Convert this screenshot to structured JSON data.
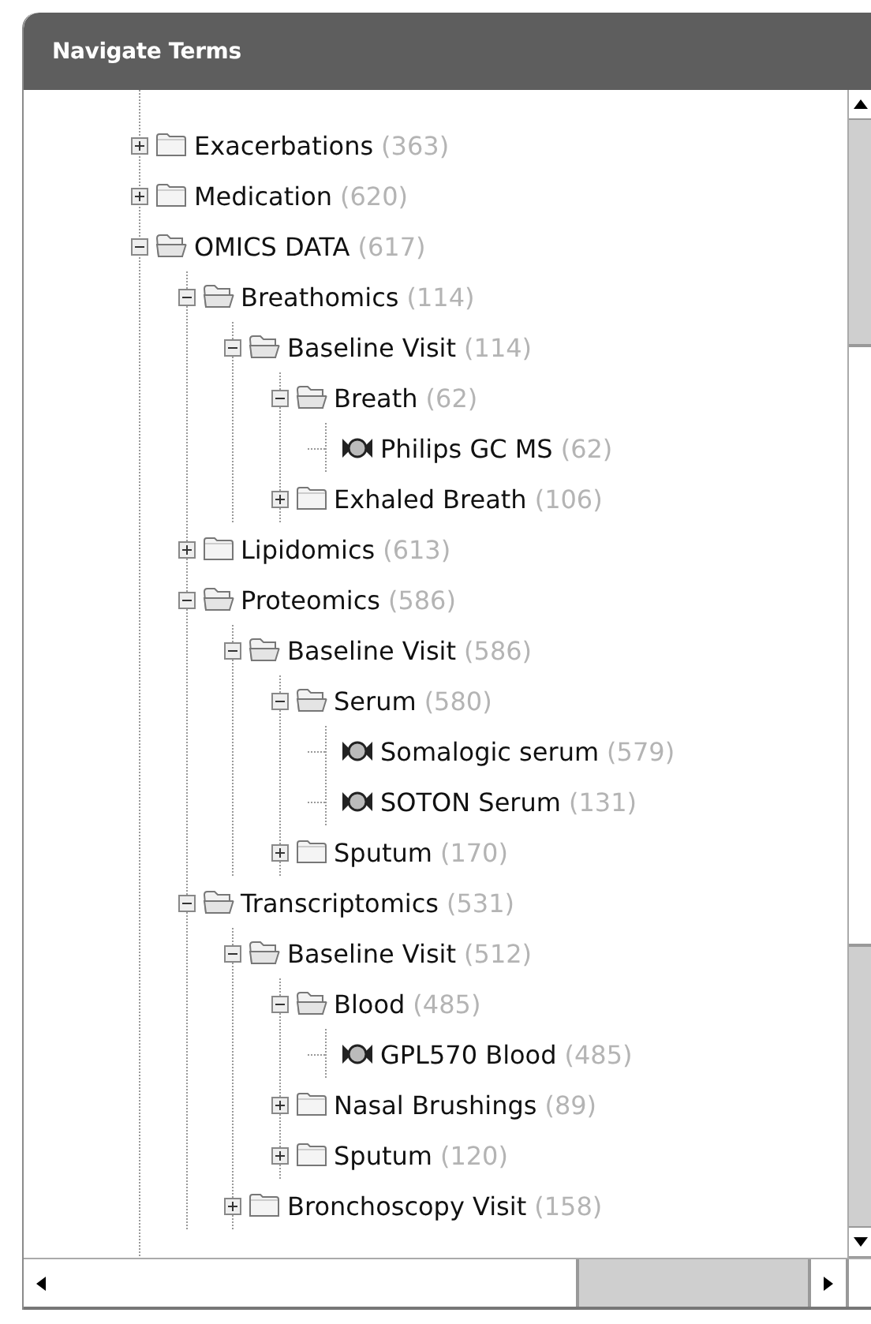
{
  "panel": {
    "title": "Navigate Terms"
  },
  "tree": [
    {
      "kind": "folder",
      "label": "Exacerbations",
      "count": "(363)",
      "expanded": false
    },
    {
      "kind": "folder",
      "label": "Medication",
      "count": "(620)",
      "expanded": false
    },
    {
      "kind": "folder",
      "label": "OMICS DATA",
      "count": "(617)",
      "expanded": true,
      "children": [
        {
          "kind": "folder",
          "label": "Breathomics",
          "count": "(114)",
          "expanded": true,
          "children": [
            {
              "kind": "folder",
              "label": "Baseline Visit",
              "count": "(114)",
              "expanded": true,
              "children": [
                {
                  "kind": "folder",
                  "label": "Breath",
                  "count": "(62)",
                  "expanded": true,
                  "children": [
                    {
                      "kind": "leaf",
                      "label": "Philips GC MS",
                      "count": "(62)"
                    }
                  ]
                },
                {
                  "kind": "folder",
                  "label": "Exhaled Breath",
                  "count": "(106)",
                  "expanded": false
                }
              ]
            }
          ]
        },
        {
          "kind": "folder",
          "label": "Lipidomics",
          "count": "(613)",
          "expanded": false
        },
        {
          "kind": "folder",
          "label": "Proteomics",
          "count": "(586)",
          "expanded": true,
          "children": [
            {
              "kind": "folder",
              "label": "Baseline Visit",
              "count": "(586)",
              "expanded": true,
              "children": [
                {
                  "kind": "folder",
                  "label": "Serum",
                  "count": "(580)",
                  "expanded": true,
                  "children": [
                    {
                      "kind": "leaf",
                      "label": "Somalogic serum",
                      "count": "(579)"
                    },
                    {
                      "kind": "leaf",
                      "label": "SOTON Serum",
                      "count": "(131)"
                    }
                  ]
                },
                {
                  "kind": "folder",
                  "label": "Sputum",
                  "count": "(170)",
                  "expanded": false
                }
              ]
            }
          ]
        },
        {
          "kind": "folder",
          "label": "Transcriptomics",
          "count": "(531)",
          "expanded": true,
          "children": [
            {
              "kind": "folder",
              "label": "Baseline Visit",
              "count": "(512)",
              "expanded": true,
              "children": [
                {
                  "kind": "folder",
                  "label": "Blood",
                  "count": "(485)",
                  "expanded": true,
                  "children": [
                    {
                      "kind": "leaf",
                      "label": "GPL570 Blood",
                      "count": "(485)"
                    }
                  ]
                },
                {
                  "kind": "folder",
                  "label": "Nasal Brushings",
                  "count": "(89)",
                  "expanded": false
                },
                {
                  "kind": "folder",
                  "label": "Sputum",
                  "count": "(120)",
                  "expanded": false
                }
              ]
            },
            {
              "kind": "folder",
              "label": "Bronchoscopy Visit",
              "count": "(158)",
              "expanded": false
            }
          ]
        }
      ]
    }
  ]
}
